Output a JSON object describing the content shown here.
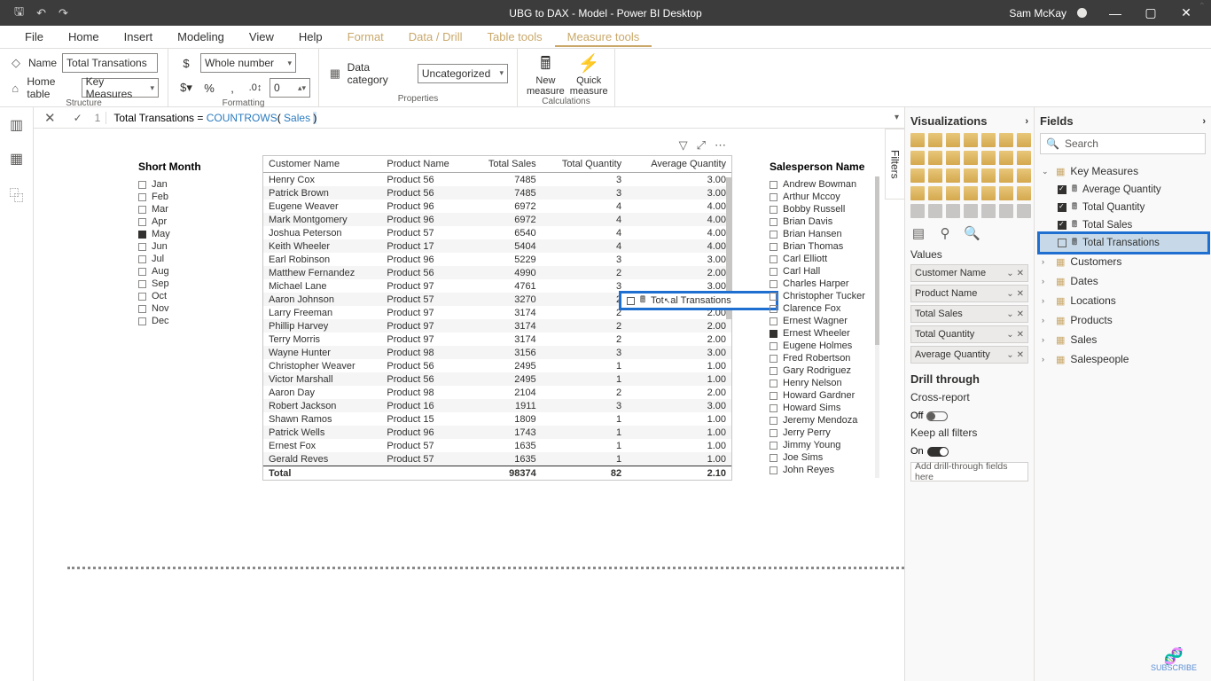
{
  "titlebar": {
    "title": "UBG to DAX - Model - Power BI Desktop",
    "user": "Sam McKay"
  },
  "menu": {
    "file": "File",
    "home": "Home",
    "insert": "Insert",
    "modeling": "Modeling",
    "view": "View",
    "help": "Help",
    "format": "Format",
    "datadrill": "Data / Drill",
    "tabletools": "Table tools",
    "measuretools": "Measure tools"
  },
  "ribbon": {
    "name_label": "Name",
    "name_value": "Total Transations",
    "hometable_label": "Home table",
    "hometable_value": "Key Measures",
    "format_label": "Whole number",
    "decimals": "0",
    "datacat_label": "Data category",
    "datacat_value": "Uncategorized",
    "newmeasure": "New\nmeasure",
    "quickmeasure": "Quick\nmeasure",
    "grp_structure": "Structure",
    "grp_formatting": "Formatting",
    "grp_properties": "Properties",
    "grp_calc": "Calculations"
  },
  "formula": {
    "line": "1",
    "text_pre": "Total Transations = ",
    "fn": "COUNTROWS",
    "open": "(",
    "arg": " Sales ",
    "close": ")"
  },
  "short_month": {
    "header": "Short Month",
    "items": [
      {
        "l": "Jan",
        "c": false
      },
      {
        "l": "Feb",
        "c": false
      },
      {
        "l": "Mar",
        "c": false
      },
      {
        "l": "Apr",
        "c": false
      },
      {
        "l": "May",
        "c": true
      },
      {
        "l": "Jun",
        "c": false
      },
      {
        "l": "Jul",
        "c": false
      },
      {
        "l": "Aug",
        "c": false
      },
      {
        "l": "Sep",
        "c": false
      },
      {
        "l": "Oct",
        "c": false
      },
      {
        "l": "Nov",
        "c": false
      },
      {
        "l": "Dec",
        "c": false
      }
    ]
  },
  "table": {
    "cols": [
      "Customer Name",
      "Product Name",
      "Total Sales",
      "Total Quantity",
      "Average Quantity"
    ],
    "rows": [
      [
        "Henry Cox",
        "Product 56",
        "7485",
        "3",
        "3.00"
      ],
      [
        "Patrick Brown",
        "Product 56",
        "7485",
        "3",
        "3.00"
      ],
      [
        "Eugene Weaver",
        "Product 96",
        "6972",
        "4",
        "4.00"
      ],
      [
        "Mark Montgomery",
        "Product 96",
        "6972",
        "4",
        "4.00"
      ],
      [
        "Joshua Peterson",
        "Product 57",
        "6540",
        "4",
        "4.00"
      ],
      [
        "Keith Wheeler",
        "Product 17",
        "5404",
        "4",
        "4.00"
      ],
      [
        "Earl Robinson",
        "Product 96",
        "5229",
        "3",
        "3.00"
      ],
      [
        "Matthew Fernandez",
        "Product 56",
        "4990",
        "2",
        "2.00"
      ],
      [
        "Michael Lane",
        "Product 97",
        "4761",
        "3",
        "3.00"
      ],
      [
        "Aaron Johnson",
        "Product 57",
        "3270",
        "2",
        "2.00"
      ],
      [
        "Larry Freeman",
        "Product 97",
        "3174",
        "2",
        "2.00"
      ],
      [
        "Phillip Harvey",
        "Product 97",
        "3174",
        "2",
        "2.00"
      ],
      [
        "Terry Morris",
        "Product 97",
        "3174",
        "2",
        "2.00"
      ],
      [
        "Wayne Hunter",
        "Product 98",
        "3156",
        "3",
        "3.00"
      ],
      [
        "Christopher Weaver",
        "Product 56",
        "2495",
        "1",
        "1.00"
      ],
      [
        "Victor Marshall",
        "Product 56",
        "2495",
        "1",
        "1.00"
      ],
      [
        "Aaron Day",
        "Product 98",
        "2104",
        "2",
        "2.00"
      ],
      [
        "Robert Jackson",
        "Product 16",
        "1911",
        "3",
        "3.00"
      ],
      [
        "Shawn Ramos",
        "Product 15",
        "1809",
        "1",
        "1.00"
      ],
      [
        "Patrick Wells",
        "Product 96",
        "1743",
        "1",
        "1.00"
      ],
      [
        "Ernest Fox",
        "Product 57",
        "1635",
        "1",
        "1.00"
      ],
      [
        "Gerald Reves",
        "Product 57",
        "1635",
        "1",
        "1.00"
      ]
    ],
    "total": [
      "Total",
      "",
      "98374",
      "82",
      "2.10"
    ]
  },
  "drag": {
    "label": "Total Transations"
  },
  "salesperson": {
    "header": "Salesperson Name",
    "items": [
      "Andrew Bowman",
      "Arthur Mccoy",
      "Bobby Russell",
      "Brian Davis",
      "Brian Hansen",
      "Brian Thomas",
      "Carl Elliott",
      "Carl Hall",
      "Charles Harper",
      "Christopher Tucker",
      "Clarence Fox",
      "Ernest Wagner",
      "Ernest Wheeler",
      "Eugene Holmes",
      "Fred Robertson",
      "Gary Rodriguez",
      "Henry Nelson",
      "Howard Gardner",
      "Howard Sims",
      "Jeremy Mendoza",
      "Jerry Perry",
      "Jimmy Young",
      "Joe Sims",
      "John Reyes"
    ],
    "checked": "Ernest Wheeler"
  },
  "visualizations": {
    "header": "Visualizations",
    "values_label": "Values",
    "wells": [
      "Customer Name",
      "Product Name",
      "Total Sales",
      "Total Quantity",
      "Average Quantity"
    ],
    "drill": "Drill through",
    "cross": "Cross-report",
    "off": "Off",
    "keep": "Keep all filters",
    "on": "On",
    "dtwell": "Add drill-through fields here"
  },
  "fields": {
    "header": "Fields",
    "search": "Search",
    "tables": [
      {
        "name": "Key Measures",
        "open": true,
        "measures": [
          {
            "n": "Average Quantity",
            "c": true
          },
          {
            "n": "Total Quantity",
            "c": true
          },
          {
            "n": "Total Sales",
            "c": true
          },
          {
            "n": "Total Transations",
            "c": false,
            "sel": true
          }
        ]
      },
      {
        "name": "Customers",
        "open": false
      },
      {
        "name": "Dates",
        "open": false
      },
      {
        "name": "Locations",
        "open": false
      },
      {
        "name": "Products",
        "open": false
      },
      {
        "name": "Sales",
        "open": false
      },
      {
        "name": "Salespeople",
        "open": false
      }
    ]
  },
  "filters_tab": "Filters",
  "logo": "SUBSCRIBE"
}
